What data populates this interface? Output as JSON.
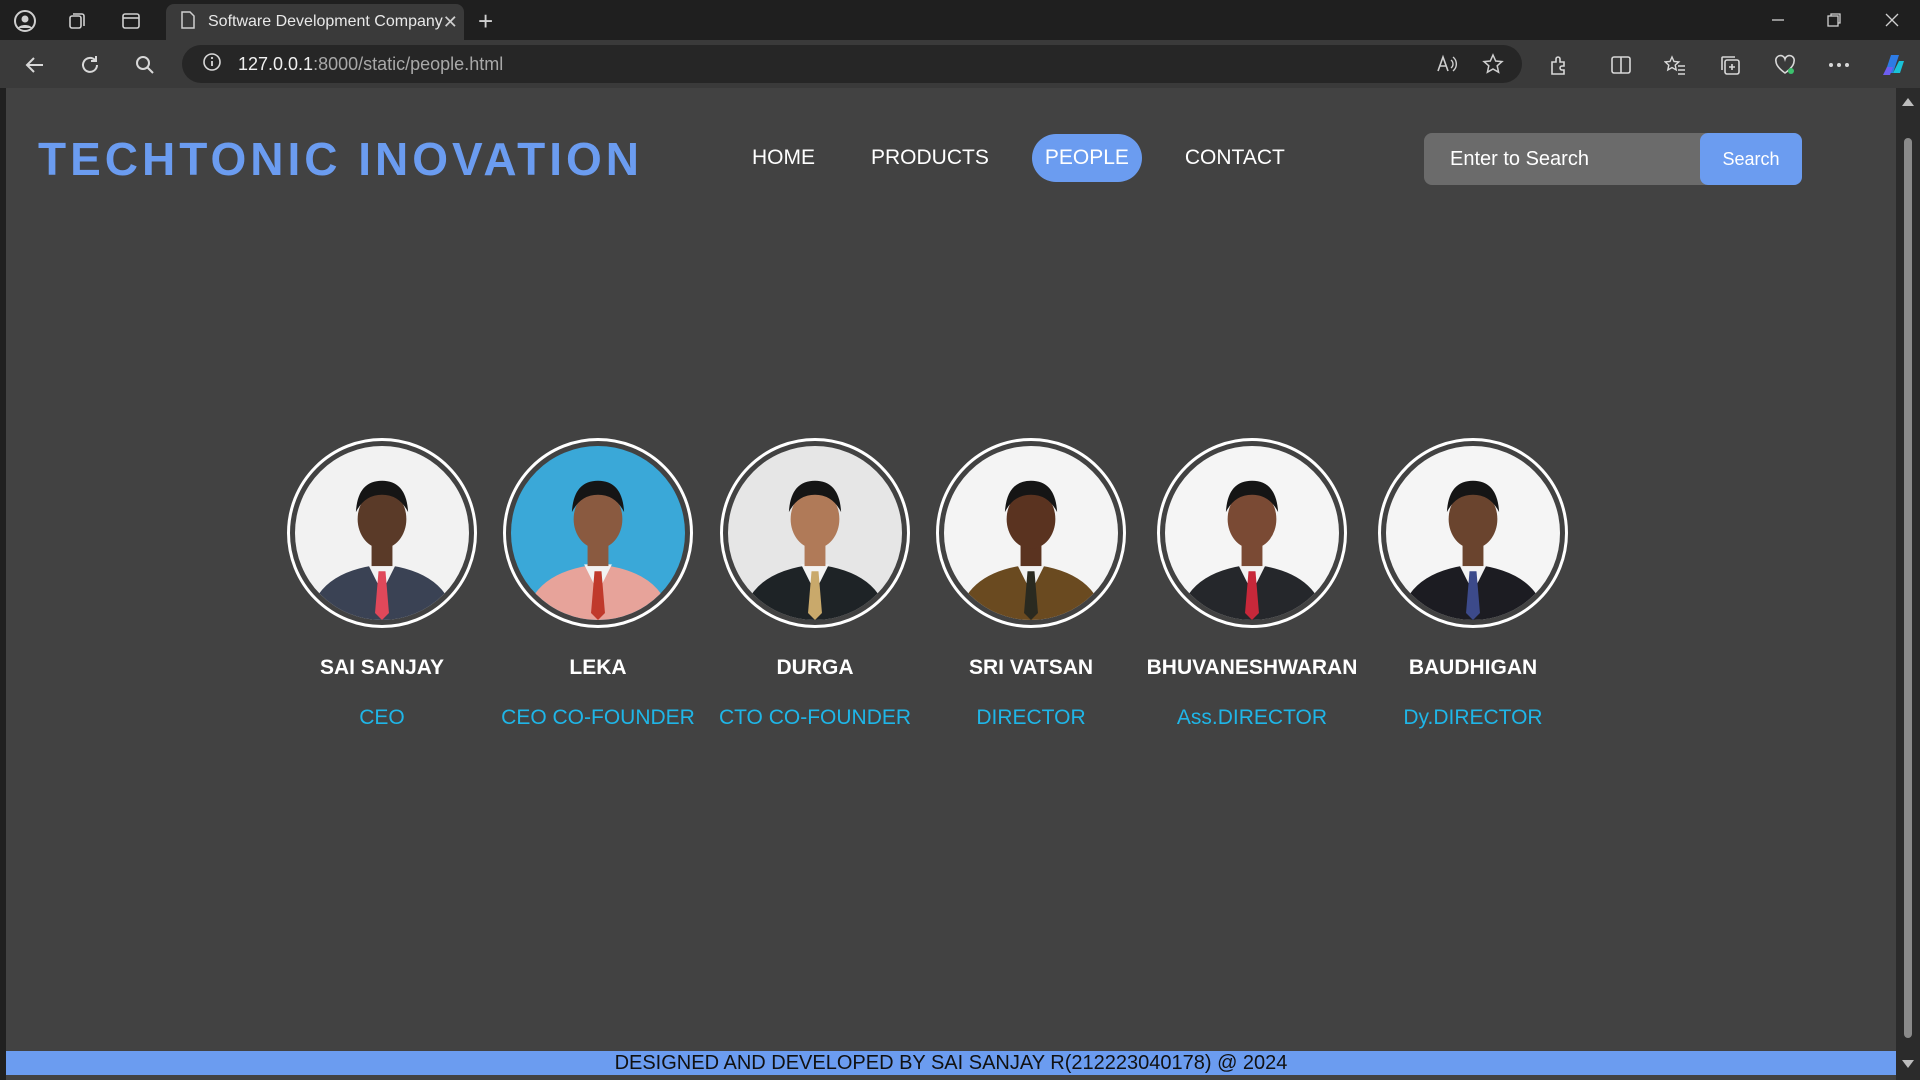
{
  "browser": {
    "tab_title": "Software Development Company",
    "tab_close": "✕",
    "new_tab": "+",
    "url_host": "127.0.0.1",
    "url_rest": ":8000/static/people.html"
  },
  "site": {
    "brand": "TECHTONIC INOVATION",
    "nav": [
      "HOME",
      "PRODUCTS",
      "PEOPLE",
      "CONTACT"
    ],
    "active_nav": "PEOPLE",
    "search": {
      "placeholder": "Enter to Search",
      "button": "Search"
    },
    "people": [
      {
        "name": "SAI SANJAY",
        "role": "CEO",
        "bg": "#f2f2f2",
        "suit": "#3a4254",
        "tie": "#e0485a",
        "skin": "#5a3a28"
      },
      {
        "name": "LEKA",
        "role": "CEO CO-FOUNDER",
        "bg": "#3aa8d8",
        "suit": "#e7a39a",
        "tie": "#c0392b",
        "skin": "#8a5a40"
      },
      {
        "name": "DURGA",
        "role": "CTO CO-FOUNDER",
        "bg": "#e6e6e6",
        "suit": "#1e2326",
        "tie": "#c9a96b",
        "skin": "#b07a58"
      },
      {
        "name": "SRI VATSAN",
        "role": "DIRECTOR",
        "bg": "#f4f4f4",
        "suit": "#6a4a20",
        "tie": "#2a2a20",
        "skin": "#5a3320"
      },
      {
        "name": "BHUVANESHWARAN",
        "role": "Ass.DIRECTOR",
        "bg": "#f5f5f5",
        "suit": "#25272b",
        "tie": "#c8283a",
        "skin": "#7a4a34"
      },
      {
        "name": "BAUDHIGAN",
        "role": "Dy.DIRECTOR",
        "bg": "#f5f5f5",
        "suit": "#1c1c22",
        "tie": "#3c4a8a",
        "skin": "#6a442e"
      }
    ],
    "footer": "DESIGNED AND DEVELOPED BY SAI SANJAY R(212223040178) @ 2024"
  }
}
